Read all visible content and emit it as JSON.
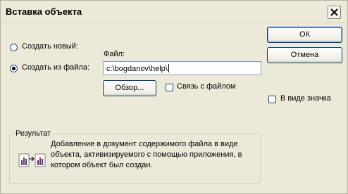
{
  "window": {
    "title": "Вставка объекта"
  },
  "buttons": {
    "ok": "ОК",
    "cancel": "Отмена",
    "browse": "Обзор..."
  },
  "options": {
    "create_new": "Создать новый:",
    "create_from_file": "Создать из файла:"
  },
  "file": {
    "label": "Файл:",
    "value": "c:\\bogdanov\\help\\"
  },
  "checkboxes": {
    "link": "Связь с файлом",
    "as_icon": "В виде значка"
  },
  "result": {
    "title": "Результат",
    "line1": "Добавление в документ содержимого файла в виде",
    "line2": "объекта, активизируемого с помощью приложения, в",
    "line3": "котором объект был создан."
  }
}
